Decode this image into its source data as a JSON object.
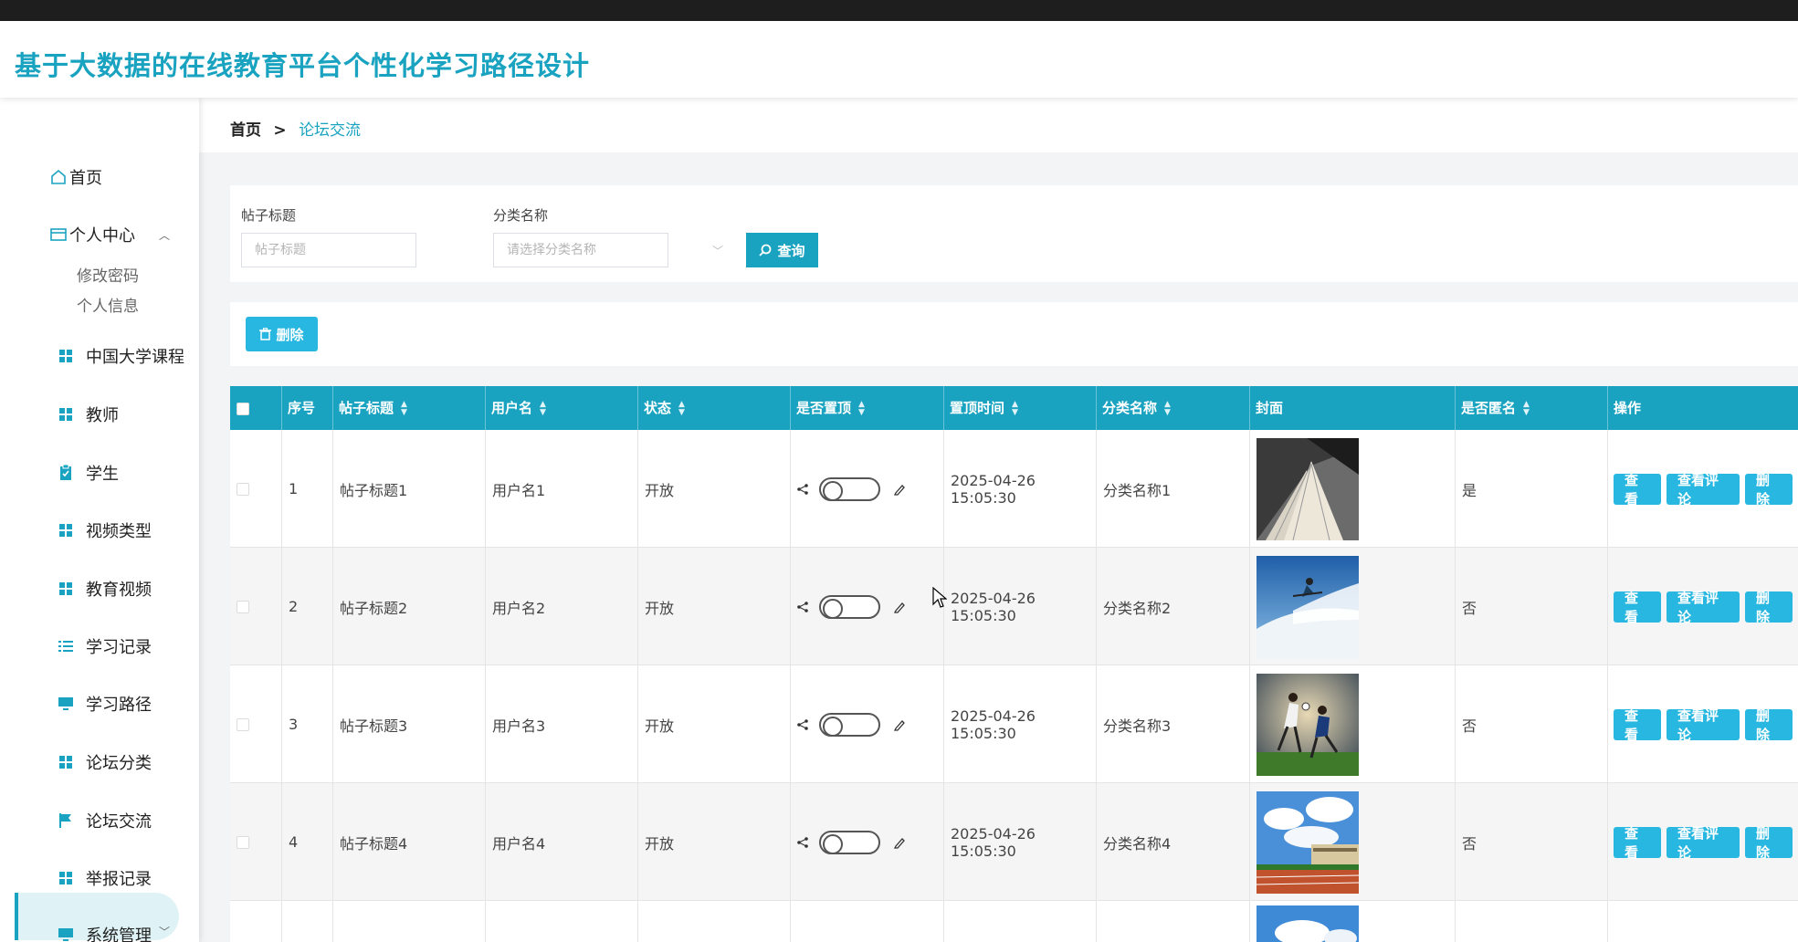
{
  "app": {
    "title": "基于大数据的在线教育平台个性化学习路径设计"
  },
  "sidebar": {
    "home": "首页",
    "personal_center": "个人中心",
    "personal_sub": [
      "修改密码",
      "个人信息"
    ],
    "items": [
      {
        "label": "中国大学课程",
        "icon": "grid-icon"
      },
      {
        "label": "教师",
        "icon": "grid-icon"
      },
      {
        "label": "学生",
        "icon": "clipboard-icon"
      },
      {
        "label": "视频类型",
        "icon": "grid-icon"
      },
      {
        "label": "教育视频",
        "icon": "grid-icon"
      },
      {
        "label": "学习记录",
        "icon": "list-icon"
      },
      {
        "label": "学习路径",
        "icon": "monitor-icon"
      },
      {
        "label": "论坛分类",
        "icon": "grid-icon"
      },
      {
        "label": "论坛交流",
        "icon": "flag-icon",
        "active": true
      },
      {
        "label": "举报记录",
        "icon": "grid-icon"
      },
      {
        "label": "系统管理",
        "icon": "monitor-icon"
      }
    ]
  },
  "breadcrumb": {
    "home": "首页",
    "separator": ">",
    "current": "论坛交流"
  },
  "search": {
    "title_label": "帖子标题",
    "title_placeholder": "帖子标题",
    "category_label": "分类名称",
    "category_placeholder": "请选择分类名称",
    "query_button": "查询"
  },
  "actions": {
    "delete_button": "删除"
  },
  "table": {
    "columns": [
      "序号",
      "帖子标题",
      "用户名",
      "状态",
      "是否置顶",
      "置顶时间",
      "分类名称",
      "封面",
      "是否匿名",
      "操作"
    ],
    "row_buttons": {
      "view": "查看",
      "view_comments": "查看评论",
      "delete": "删除"
    },
    "rows": [
      {
        "index": "1",
        "title": "帖子标题1",
        "username": "用户名1",
        "status": "开放",
        "pinned": false,
        "pin_time": "2025-04-26 15:05:30",
        "category": "分类名称1",
        "cover": "book-cover",
        "anonymous": "是"
      },
      {
        "index": "2",
        "title": "帖子标题2",
        "username": "用户名2",
        "status": "开放",
        "pinned": false,
        "pin_time": "2025-04-26 15:05:30",
        "category": "分类名称2",
        "cover": "skier-cover",
        "anonymous": "否"
      },
      {
        "index": "3",
        "title": "帖子标题3",
        "username": "用户名3",
        "status": "开放",
        "pinned": false,
        "pin_time": "2025-04-26 15:05:30",
        "category": "分类名称3",
        "cover": "soccer-cover",
        "anonymous": "否"
      },
      {
        "index": "4",
        "title": "帖子标题4",
        "username": "用户名4",
        "status": "开放",
        "pinned": false,
        "pin_time": "2025-04-26 15:05:30",
        "category": "分类名称4",
        "cover": "stadium-cover",
        "anonymous": "否"
      }
    ]
  },
  "colors": {
    "primary": "#1aa3c0",
    "button": "#27b7e0",
    "header_bg": "#ffffff"
  }
}
